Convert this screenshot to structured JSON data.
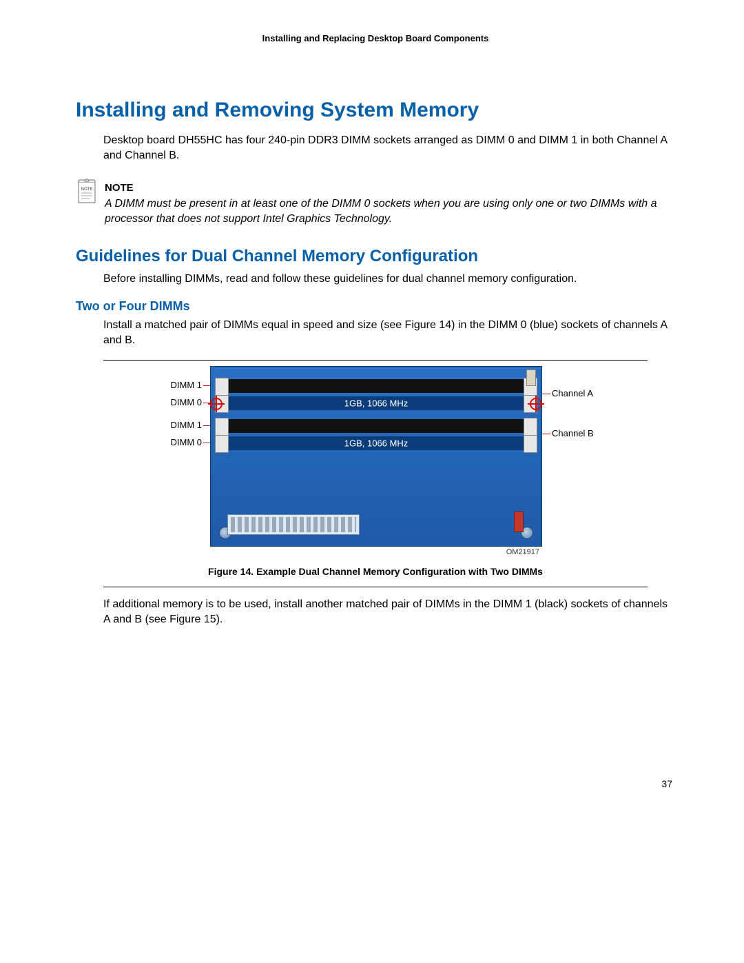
{
  "header": {
    "running": "Installing and Replacing Desktop Board Components"
  },
  "h1": "Installing and Removing System Memory",
  "intro": "Desktop board DH55HC has four 240-pin DDR3 DIMM sockets arranged as DIMM 0 and DIMM 1 in both Channel A and Channel B.",
  "note": {
    "label": "NOTE",
    "icon_text": "NOTE",
    "text": "A DIMM must be present in at least one of the DIMM 0 sockets when you are using only one or two DIMMs with a processor that does not support Intel Graphics Technology."
  },
  "h2": "Guidelines for Dual Channel Memory Configuration",
  "guidelines_intro": "Before installing DIMMs, read and follow these guidelines for dual channel memory configuration.",
  "h3": "Two or Four DIMMs",
  "two_dimms_text": "Install a matched pair of DIMMs equal in speed and size (see Figure 14) in the DIMM 0 (blue) sockets of channels A and B.",
  "figure": {
    "caption": "Figure 14.  Example Dual Channel Memory Configuration with Two DIMMs",
    "om_id": "OM21917",
    "labels": {
      "dimm1_a": "DIMM 1",
      "dimm0_a": "DIMM 0",
      "dimm1_b": "DIMM 1",
      "dimm0_b": "DIMM 0",
      "channel_a": "Channel A",
      "channel_b": "Channel B",
      "mem_spec": "1GB, 1066 MHz"
    }
  },
  "after_figure": "If additional memory is to be used, install another matched pair of DIMMs in the DIMM 1 (black) sockets of channels A and B (see Figure 15).",
  "page_number": "37"
}
